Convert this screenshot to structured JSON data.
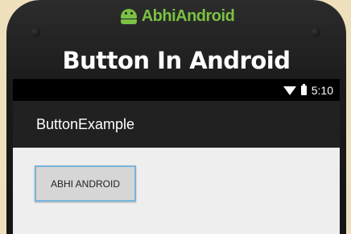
{
  "brand": {
    "name": "AbhiAndroid",
    "color": "#7bc143",
    "icon": "android-robot-icon"
  },
  "headline": "Button In Android",
  "status_bar": {
    "wifi_icon": "wifi-icon",
    "battery_icon": "battery-icon",
    "time": "5:10"
  },
  "action_bar": {
    "title": "ButtonExample"
  },
  "button": {
    "label": "ABHI ANDROID",
    "border_color": "#76b4dc"
  }
}
